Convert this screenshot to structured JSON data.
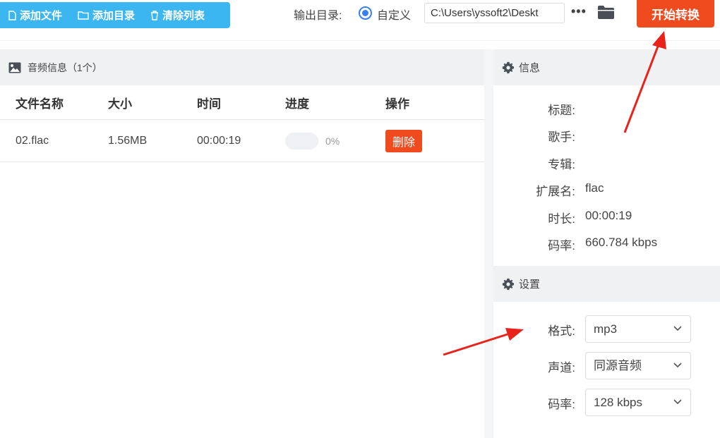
{
  "toolbar": {
    "add_file": "添加文件",
    "add_dir": "添加目录",
    "clear_list": "清除列表",
    "output_label": "输出目录:",
    "custom_label": "自定义",
    "output_path": "C:\\Users\\yssoft2\\Deskt",
    "more": "•••",
    "start": "开始转换"
  },
  "file_panel": {
    "header": "音频信息（1个）",
    "columns": [
      "文件名称",
      "大小",
      "时间",
      "进度",
      "操作"
    ],
    "rows": [
      {
        "name": "02.flac",
        "size": "1.56MB",
        "time": "00:00:19",
        "progress": "0%",
        "progress_value": 0,
        "action": "删除"
      }
    ]
  },
  "info_panel": {
    "header": "信息",
    "fields": [
      {
        "label": "标题:",
        "value": ""
      },
      {
        "label": "歌手:",
        "value": ""
      },
      {
        "label": "专辑:",
        "value": ""
      },
      {
        "label": "扩展名:",
        "value": "flac"
      },
      {
        "label": "时长:",
        "value": "00:00:19"
      },
      {
        "label": "码率:",
        "value": "660.784 kbps"
      }
    ]
  },
  "settings_panel": {
    "header": "设置",
    "fields": [
      {
        "label": "格式:",
        "value": "mp3"
      },
      {
        "label": "声道:",
        "value": "同源音频"
      },
      {
        "label": "码率:",
        "value": "128 kbps"
      }
    ]
  },
  "colors": {
    "toolbar_blue": "#3cb6f0",
    "accent_red": "#ef4b1f",
    "radio_blue": "#3a7ff2",
    "annotation_red": "#e8231b"
  }
}
